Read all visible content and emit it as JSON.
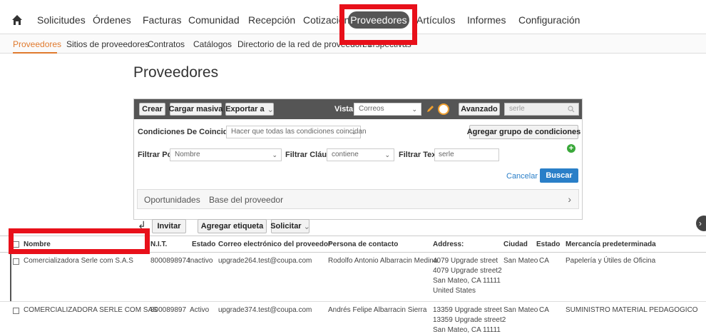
{
  "nav": {
    "items": [
      "Solicitudes",
      "Órdenes",
      "Facturas",
      "Comunidad",
      "Recepción",
      "Cotización",
      "Proveedores",
      "Artículos",
      "Informes",
      "Configuración"
    ],
    "active": "Proveedores"
  },
  "subnav": {
    "items": [
      "Proveedores",
      "Sitios de proveedores",
      "Contratos",
      "Catálogos",
      "Directorio de la red de proveedores",
      "Perspectivas"
    ]
  },
  "page_title": "Proveedores",
  "toolbar": {
    "crear": "Crear",
    "cargar_masiva": "Cargar masiva",
    "exportar": "Exportar a",
    "vista_label": "Vista",
    "vista_value": "Correos",
    "avanzado": "Avanzado",
    "search_value": "serle"
  },
  "conditions": {
    "label": "Condiciones De Coincidencia",
    "value": "Hacer que todas las condiciones coincidan",
    "add_group": "Agregar grupo de condiciones"
  },
  "filter": {
    "por_label": "Filtrar Por",
    "por_value": "Nombre",
    "clausula_label": "Filtrar Cláusula",
    "clausula_value": "contiene",
    "texto_label": "Filtrar Texto",
    "texto_value": "serle",
    "cancelar": "Cancelar",
    "buscar": "Buscar"
  },
  "tabs": [
    "Oportunidades",
    "Base del proveedor"
  ],
  "actions": {
    "invitar": "Invitar",
    "agregar_etiqueta": "Agregar etiqueta",
    "solicitar": "Solicitar"
  },
  "table": {
    "headers": [
      "Nombre",
      "N.I.T.",
      "Estado",
      "Correo electrónico del proveedor",
      "Persona de contacto",
      "Address:",
      "Ciudad",
      "Estado",
      "Mercancía predeterminada"
    ],
    "rows": [
      {
        "nombre": "Comercializadora Serle com S.A.S",
        "nit": "8000898974",
        "estado": "Inactivo",
        "correo": "upgrade264.test@coupa.com",
        "contacto": "Rodolfo Antonio Albarracin Medina",
        "address": [
          "4079 Upgrade street",
          "4079 Upgrade street2",
          "San Mateo, CA 11111",
          "United States"
        ],
        "ciudad": "San Mateo",
        "estado2": "CA",
        "mercancia": "Papelería y Útiles de Oficina"
      },
      {
        "nombre": "COMERCIALIZADORA SERLE COM SAS",
        "nit": "800089897",
        "estado": "Activo",
        "correo": "upgrade374.test@coupa.com",
        "contacto": "Andrés Felipe Albarracin Sierra",
        "address": [
          "13359 Upgrade street",
          "13359 Upgrade street2",
          "San Mateo, CA 11111"
        ],
        "ciudad": "San Mateo",
        "estado2": "CA",
        "mercancia": "SUMINISTRO MATERIAL PEDAGOGICO"
      }
    ]
  },
  "colors": {
    "highlight": "#e8101a",
    "accent_orange": "#e07a2e",
    "link_blue": "#2a7fc8",
    "toolbar_gray": "#555555"
  },
  "icons": [
    "home-icon",
    "pencil-icon",
    "clock-icon",
    "search-icon",
    "plus-icon",
    "back-arrow-icon",
    "chevron-right-icon",
    "chevron-down-icon"
  ]
}
